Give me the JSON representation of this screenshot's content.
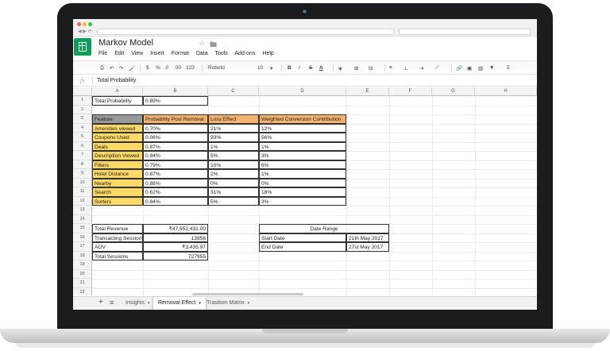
{
  "doc": {
    "title": "Markov Model"
  },
  "menu": [
    "File",
    "Edit",
    "View",
    "Insert",
    "Format",
    "Data",
    "Tools",
    "Add-ons",
    "Help"
  ],
  "toolbar": {
    "currency": "$",
    "percent": "%",
    "dec_less": ".0",
    "dec_more": ".00",
    "more_formats": "123",
    "font": "Roboto",
    "size": "10",
    "bold": "B",
    "italic": "I",
    "strike": "S",
    "text_color": "A"
  },
  "formula": {
    "fx": "fx",
    "value": "Total Probability"
  },
  "columns": [
    "A",
    "B",
    "C",
    "D",
    "E",
    "F",
    "G",
    "H"
  ],
  "rows": [
    "1",
    "2",
    "3",
    "4",
    "5",
    "6",
    "7",
    "8",
    "9",
    "10",
    "11",
    "12",
    "13",
    "14",
    "15",
    "16",
    "17",
    "18",
    "19",
    "20",
    "21",
    "22"
  ],
  "summary": {
    "label": "Total Probability",
    "value": "0.89%"
  },
  "table": {
    "headers": [
      "Feature",
      "Probability Post Removal",
      "Loss Effect",
      "Weighted Conversion Contribution"
    ],
    "rows": [
      [
        "Amenities viewed",
        "0.70%",
        "21%",
        "12%"
      ],
      [
        "Coupons Used",
        "0.06%",
        "93%",
        "56%"
      ],
      [
        "Deals",
        "0.87%",
        "1%",
        "1%"
      ],
      [
        "Description Viewed",
        "0.84%",
        "5%",
        "3%"
      ],
      [
        "Filters",
        "0.79%",
        "10%",
        "6%"
      ],
      [
        "Hotel Distance",
        "0.87%",
        "2%",
        "1%"
      ],
      [
        "Nearby",
        "0.88%",
        "0%",
        "0%"
      ],
      [
        "Search",
        "0.62%",
        "31%",
        "18%"
      ],
      [
        "Sorters",
        "0.84%",
        "5%",
        "3%"
      ]
    ]
  },
  "metrics": [
    [
      "Total Revenue",
      "₹47,952,431.00"
    ],
    [
      "Transacting Sessions",
      "13956"
    ],
    [
      "AOV",
      "₹3,435.97"
    ],
    [
      "Total Sessions",
      "727955"
    ]
  ],
  "date_range": {
    "title": "Date Range",
    "rows": [
      [
        "Start Date",
        "21th May 2017"
      ],
      [
        "End Date",
        "27st May 2017"
      ]
    ]
  },
  "sheet_tabs": [
    {
      "label": "Insights",
      "active": false
    },
    {
      "label": "Removal Effect",
      "active": true
    },
    {
      "label": "Trasition Matrix",
      "active": false
    }
  ],
  "tab_controls": {
    "add": "+",
    "list": "≡"
  },
  "colors": {
    "sheets_green": "#0f9d58",
    "header_grey": "#999999",
    "header_orange": "#f6b26b",
    "feature_yellow": "#ffd966"
  }
}
